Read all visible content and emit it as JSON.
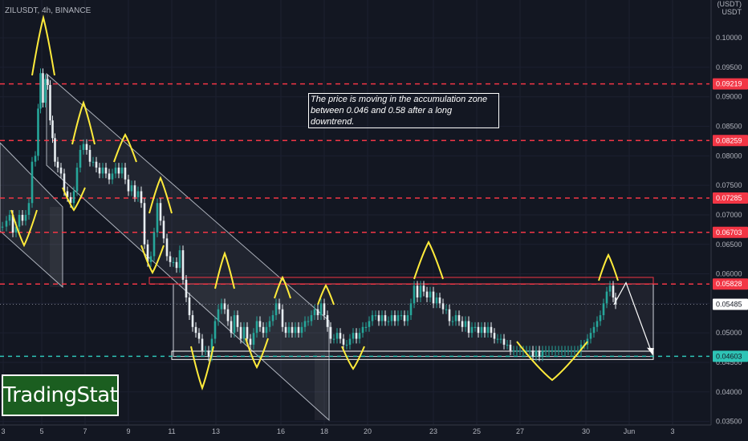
{
  "header": {
    "symbol": "ZILUSDT, 4h, BINANCE",
    "currency_top": "(USDT)",
    "currency": "USDT"
  },
  "annotation": {
    "line1": "The price is moving in the accumulation zone",
    "line2": "between 0.046 and 0.58 after a long downtrend."
  },
  "logo": {
    "text": "TradingStat"
  },
  "colors": {
    "background": "#131722",
    "bull": "#26a69a",
    "bear": "#e8eef2",
    "red_line": "#f23645",
    "green_line": "#2ec4b6",
    "highlight": "#ffeb3b",
    "logo_bg": "#1b5e20"
  },
  "chart_data": {
    "type": "candlestick",
    "title": "ZILUSDT, 4h, BINANCE",
    "ylim": [
      0.0344,
      0.1064
    ],
    "y_ticks": [
      0.035,
      0.04,
      0.045,
      0.05,
      0.055,
      0.06,
      0.065,
      0.07,
      0.075,
      0.08,
      0.085,
      0.09,
      0.095,
      0.1
    ],
    "y_tick_labels": [
      "0.03500",
      "0.04000",
      "0.04500",
      "0.05000",
      "0.05500",
      "0.06000",
      "0.06500",
      "0.07000",
      "0.07500",
      "0.08000",
      "0.08500",
      "0.09000",
      "0.09500",
      "0.10000"
    ],
    "x_tick_labels": [
      "3",
      "5",
      "7",
      "9",
      "11",
      "13",
      "16",
      "18",
      "20",
      "23",
      "25",
      "27",
      "30",
      "Jun",
      "3"
    ],
    "resistance_levels": [
      {
        "value": 0.09219,
        "label": "0.09219"
      },
      {
        "value": 0.08259,
        "label": "0.08259"
      },
      {
        "value": 0.07285,
        "label": "0.07285"
      },
      {
        "value": 0.06703,
        "label": "0.06703"
      },
      {
        "value": 0.05828,
        "label": "0.05828"
      }
    ],
    "support_level": {
      "value": 0.04603,
      "label": "0.04603"
    },
    "current_price": {
      "value": 0.05485,
      "label": "0.05485"
    },
    "accumulation_zone": {
      "low": 0.046,
      "high": 0.0583
    },
    "price_path": [
      [
        0,
        0.068
      ],
      [
        6,
        0.068
      ],
      [
        10,
        0.069
      ],
      [
        14,
        0.07
      ],
      [
        18,
        0.067
      ],
      [
        22,
        0.068
      ],
      [
        26,
        0.07
      ],
      [
        30,
        0.069
      ],
      [
        34,
        0.07
      ],
      [
        38,
        0.072
      ],
      [
        42,
        0.079
      ],
      [
        46,
        0.08
      ],
      [
        49,
        0.088
      ],
      [
        52,
        0.094
      ],
      [
        55,
        0.089
      ],
      [
        58,
        0.093
      ],
      [
        61,
        0.092
      ],
      [
        64,
        0.086
      ],
      [
        67,
        0.083
      ],
      [
        70,
        0.079
      ],
      [
        74,
        0.078
      ],
      [
        78,
        0.077
      ],
      [
        82,
        0.074
      ],
      [
        86,
        0.073
      ],
      [
        90,
        0.072
      ],
      [
        94,
        0.074
      ],
      [
        98,
        0.078
      ],
      [
        102,
        0.081
      ],
      [
        106,
        0.082
      ],
      [
        110,
        0.081
      ],
      [
        114,
        0.079
      ],
      [
        118,
        0.079
      ],
      [
        122,
        0.078
      ],
      [
        126,
        0.077
      ],
      [
        130,
        0.078
      ],
      [
        134,
        0.077
      ],
      [
        138,
        0.076
      ],
      [
        142,
        0.077
      ],
      [
        146,
        0.078
      ],
      [
        150,
        0.077
      ],
      [
        154,
        0.078
      ],
      [
        158,
        0.076
      ],
      [
        162,
        0.074
      ],
      [
        166,
        0.075
      ],
      [
        170,
        0.073
      ],
      [
        174,
        0.074
      ],
      [
        178,
        0.072
      ],
      [
        182,
        0.065
      ],
      [
        186,
        0.062
      ],
      [
        190,
        0.063
      ],
      [
        194,
        0.067
      ],
      [
        198,
        0.072
      ],
      [
        202,
        0.069
      ],
      [
        206,
        0.066
      ],
      [
        210,
        0.063
      ],
      [
        214,
        0.062
      ],
      [
        218,
        0.062
      ],
      [
        222,
        0.061
      ],
      [
        226,
        0.064
      ],
      [
        230,
        0.059
      ],
      [
        234,
        0.056
      ],
      [
        238,
        0.053
      ],
      [
        242,
        0.051
      ],
      [
        246,
        0.05
      ],
      [
        250,
        0.049
      ],
      [
        254,
        0.047
      ],
      [
        258,
        0.047
      ],
      [
        262,
        0.046
      ],
      [
        266,
        0.049
      ],
      [
        270,
        0.052
      ],
      [
        274,
        0.054
      ],
      [
        278,
        0.055
      ],
      [
        282,
        0.054
      ],
      [
        286,
        0.052
      ],
      [
        290,
        0.05
      ],
      [
        294,
        0.053
      ],
      [
        298,
        0.051
      ],
      [
        302,
        0.049
      ],
      [
        306,
        0.051
      ],
      [
        310,
        0.049
      ],
      [
        314,
        0.048
      ],
      [
        318,
        0.05
      ],
      [
        322,
        0.052
      ],
      [
        326,
        0.051
      ],
      [
        330,
        0.05
      ],
      [
        334,
        0.051
      ],
      [
        338,
        0.052
      ],
      [
        342,
        0.053
      ],
      [
        346,
        0.055
      ],
      [
        350,
        0.054
      ],
      [
        354,
        0.051
      ],
      [
        358,
        0.05
      ],
      [
        362,
        0.051
      ],
      [
        366,
        0.05
      ],
      [
        370,
        0.051
      ],
      [
        374,
        0.05
      ],
      [
        378,
        0.051
      ],
      [
        382,
        0.052
      ],
      [
        386,
        0.052
      ],
      [
        390,
        0.053
      ],
      [
        394,
        0.054
      ],
      [
        398,
        0.053
      ],
      [
        402,
        0.055
      ],
      [
        406,
        0.053
      ],
      [
        410,
        0.051
      ],
      [
        414,
        0.049
      ],
      [
        418,
        0.049
      ],
      [
        422,
        0.05
      ],
      [
        426,
        0.049
      ],
      [
        430,
        0.048
      ],
      [
        434,
        0.048
      ],
      [
        438,
        0.049
      ],
      [
        442,
        0.05
      ],
      [
        446,
        0.049
      ],
      [
        450,
        0.05
      ],
      [
        454,
        0.051
      ],
      [
        458,
        0.051
      ],
      [
        462,
        0.052
      ],
      [
        466,
        0.053
      ],
      [
        470,
        0.053
      ],
      [
        474,
        0.052
      ],
      [
        478,
        0.053
      ],
      [
        482,
        0.052
      ],
      [
        486,
        0.052
      ],
      [
        490,
        0.053
      ],
      [
        494,
        0.052
      ],
      [
        498,
        0.053
      ],
      [
        502,
        0.053
      ],
      [
        506,
        0.052
      ],
      [
        510,
        0.053
      ],
      [
        514,
        0.055
      ],
      [
        518,
        0.058
      ],
      [
        522,
        0.056
      ],
      [
        526,
        0.058
      ],
      [
        530,
        0.057
      ],
      [
        534,
        0.056
      ],
      [
        538,
        0.057
      ],
      [
        542,
        0.055
      ],
      [
        546,
        0.056
      ],
      [
        550,
        0.055
      ],
      [
        554,
        0.054
      ],
      [
        558,
        0.054
      ],
      [
        562,
        0.052
      ],
      [
        566,
        0.052
      ],
      [
        570,
        0.053
      ],
      [
        574,
        0.052
      ],
      [
        578,
        0.051
      ],
      [
        582,
        0.052
      ],
      [
        586,
        0.05
      ],
      [
        590,
        0.051
      ],
      [
        594,
        0.051
      ],
      [
        598,
        0.05
      ],
      [
        602,
        0.051
      ],
      [
        606,
        0.05
      ],
      [
        610,
        0.051
      ],
      [
        614,
        0.05
      ],
      [
        618,
        0.049
      ],
      [
        622,
        0.049
      ],
      [
        626,
        0.049
      ],
      [
        630,
        0.048
      ],
      [
        634,
        0.048
      ],
      [
        638,
        0.047
      ],
      [
        642,
        0.047
      ],
      [
        646,
        0.047
      ],
      [
        650,
        0.047
      ],
      [
        654,
        0.047
      ],
      [
        658,
        0.047
      ],
      [
        662,
        0.047
      ],
      [
        666,
        0.046
      ],
      [
        670,
        0.047
      ],
      [
        674,
        0.046
      ],
      [
        678,
        0.047
      ],
      [
        682,
        0.047
      ],
      [
        686,
        0.047
      ],
      [
        690,
        0.047
      ],
      [
        694,
        0.047
      ],
      [
        698,
        0.047
      ],
      [
        702,
        0.047
      ],
      [
        706,
        0.047
      ],
      [
        710,
        0.047
      ],
      [
        714,
        0.047
      ],
      [
        718,
        0.047
      ],
      [
        722,
        0.047
      ],
      [
        726,
        0.048
      ],
      [
        730,
        0.048
      ],
      [
        734,
        0.049
      ],
      [
        738,
        0.05
      ],
      [
        742,
        0.051
      ],
      [
        746,
        0.052
      ],
      [
        750,
        0.053
      ],
      [
        754,
        0.055
      ],
      [
        758,
        0.057
      ],
      [
        762,
        0.058
      ],
      [
        766,
        0.056
      ],
      [
        768,
        0.05485
      ]
    ]
  }
}
